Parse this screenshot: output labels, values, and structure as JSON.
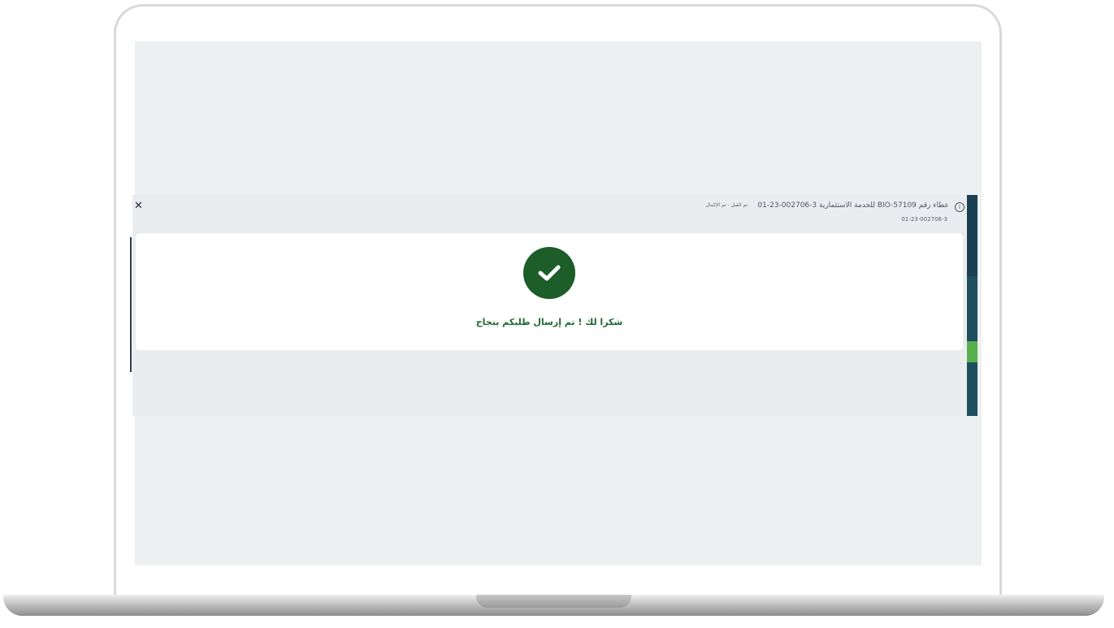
{
  "header": {
    "title": "عطاء رقم BIO-57109 للخدمة الاستثمارية 3-002706-23-01",
    "status": "تم القبل - تم الإكمال",
    "request_number": "01-23-002706-3"
  },
  "icons": {
    "close": "close-icon",
    "info": "info-icon",
    "success": "check-circle-icon"
  },
  "message": {
    "success": "شكرا لك ! تم إرسال طلبكم بنجاح"
  },
  "colors": {
    "success_green": "#1c5d2a",
    "success_text": "#1e6a30",
    "sidebar_teal": "#1f4e5f",
    "accent_green": "#55b04c"
  }
}
